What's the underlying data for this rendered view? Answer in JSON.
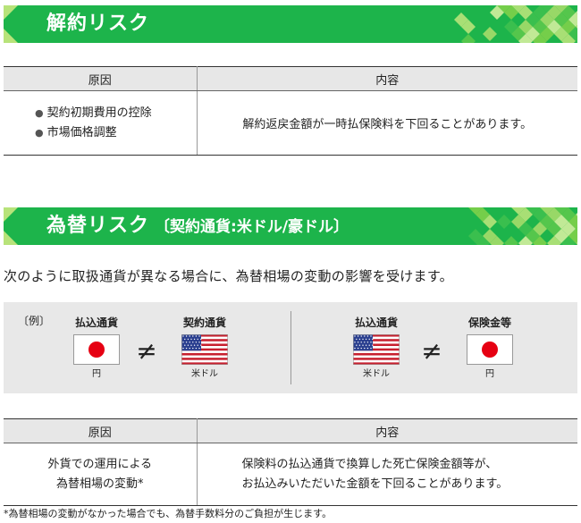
{
  "section1": {
    "title": "解約リスク",
    "table": {
      "headers": [
        "原因",
        "内容"
      ],
      "causes": [
        "契約初期費用の控除",
        "市場価格調整"
      ],
      "content": "解約返戻金額が一時払保険料を下回ることがあります。"
    }
  },
  "section2": {
    "title": "為替リスク",
    "subtitle": "〔契約通貨:米ドル/豪ドル〕",
    "intro": "次のように取扱通貨が異なる場合に、為替相場の変動の影響を受けます。",
    "example": {
      "tag": "〔例〕",
      "left": {
        "a_label": "払込通貨",
        "a_flag": "japan-flag-icon",
        "a_caption": "円",
        "b_label": "契約通貨",
        "b_flag": "usa-flag-icon",
        "b_caption": "米ドル",
        "symbol": "≠"
      },
      "right": {
        "a_label": "払込通貨",
        "a_flag": "usa-flag-icon",
        "a_caption": "米ドル",
        "b_label": "保険金等",
        "b_flag": "japan-flag-icon",
        "b_caption": "円",
        "symbol": "≠"
      }
    },
    "table": {
      "headers": [
        "原因",
        "内容"
      ],
      "cause_lines": [
        "外貨での運用による",
        "為替相場の変動*"
      ],
      "content_lines": [
        "保険料の払込通貨で換算した死亡保険金額等が、",
        "お払込みいただいた金額を下回ることがあります。"
      ]
    },
    "footnote": "*為替相場の変動がなかった場合でも、為替手数料分のご負担が生じます。"
  },
  "colors": {
    "banner_green": "#1db44b",
    "header_gray": "#e7e7e7",
    "flag_red": "#e60012",
    "us_blue": "#2a3f8f",
    "us_red": "#c8202f"
  }
}
